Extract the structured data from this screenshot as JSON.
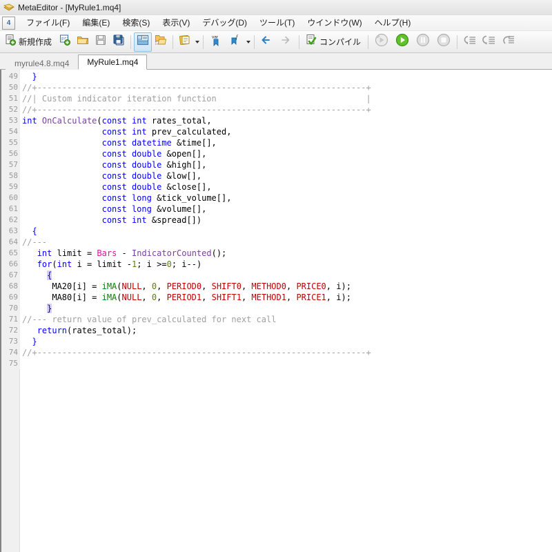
{
  "window": {
    "title": "MetaEditor - [MyRule1.mq4]",
    "icon": "metaeditor-diamond-icon"
  },
  "menubar": {
    "app_icon_label": "4",
    "items": [
      {
        "label": "ファイル(F)",
        "name": "menu-file"
      },
      {
        "label": "編集(E)",
        "name": "menu-edit"
      },
      {
        "label": "検索(S)",
        "name": "menu-search"
      },
      {
        "label": "表示(V)",
        "name": "menu-view"
      },
      {
        "label": "デバッグ(D)",
        "name": "menu-debug"
      },
      {
        "label": "ツール(T)",
        "name": "menu-tools"
      },
      {
        "label": "ウインドウ(W)",
        "name": "menu-window"
      },
      {
        "label": "ヘルプ(H)",
        "name": "menu-help"
      }
    ]
  },
  "toolbar": {
    "new_label": "新規作成",
    "compile_label": "コンパイル",
    "icons": [
      "new-file-icon",
      "new-project-icon",
      "open-folder-icon",
      "save-icon",
      "save-all-icon",
      "navigator-panel-icon",
      "open-data-folder-icon",
      "notes-icon",
      "variable-icon",
      "function-icon",
      "back-arrow-icon",
      "forward-arrow-icon",
      "compile-icon",
      "debug-step-icon",
      "start-icon",
      "pause-icon",
      "stop-icon",
      "step-into-icon",
      "step-over-icon",
      "step-out-icon"
    ]
  },
  "tabs": [
    {
      "label": "myrule4.8.mq4",
      "active": false
    },
    {
      "label": "MyRule1.mq4",
      "active": true
    }
  ],
  "editor": {
    "first_line": 49,
    "lines": [
      {
        "n": 49,
        "tokens": [
          {
            "t": "  ",
            "c": "plain"
          },
          {
            "t": "}",
            "c": "kw"
          }
        ]
      },
      {
        "n": 50,
        "tokens": [
          {
            "t": "//+------------------------------------------------------------------+",
            "c": "cmt"
          }
        ]
      },
      {
        "n": 51,
        "tokens": [
          {
            "t": "//| Custom indicator iteration function                              |",
            "c": "cmt"
          }
        ]
      },
      {
        "n": 52,
        "tokens": [
          {
            "t": "//+------------------------------------------------------------------+",
            "c": "cmt"
          }
        ]
      },
      {
        "n": 53,
        "tokens": [
          {
            "t": "int",
            "c": "kw"
          },
          {
            "t": " ",
            "c": "plain"
          },
          {
            "t": "OnCalculate",
            "c": "fn"
          },
          {
            "t": "(",
            "c": "plain"
          },
          {
            "t": "const",
            "c": "kw"
          },
          {
            "t": " ",
            "c": "plain"
          },
          {
            "t": "int",
            "c": "kw"
          },
          {
            "t": " rates_total,",
            "c": "plain"
          }
        ]
      },
      {
        "n": 54,
        "tokens": [
          {
            "t": "                ",
            "c": "plain"
          },
          {
            "t": "const",
            "c": "kw"
          },
          {
            "t": " ",
            "c": "plain"
          },
          {
            "t": "int",
            "c": "kw"
          },
          {
            "t": " prev_calculated,",
            "c": "plain"
          }
        ]
      },
      {
        "n": 55,
        "tokens": [
          {
            "t": "                ",
            "c": "plain"
          },
          {
            "t": "const",
            "c": "kw"
          },
          {
            "t": " ",
            "c": "plain"
          },
          {
            "t": "datetime",
            "c": "kw"
          },
          {
            "t": " &time[],",
            "c": "plain"
          }
        ]
      },
      {
        "n": 56,
        "tokens": [
          {
            "t": "                ",
            "c": "plain"
          },
          {
            "t": "const",
            "c": "kw"
          },
          {
            "t": " ",
            "c": "plain"
          },
          {
            "t": "double",
            "c": "kw"
          },
          {
            "t": " &open[],",
            "c": "plain"
          }
        ]
      },
      {
        "n": 57,
        "tokens": [
          {
            "t": "                ",
            "c": "plain"
          },
          {
            "t": "const",
            "c": "kw"
          },
          {
            "t": " ",
            "c": "plain"
          },
          {
            "t": "double",
            "c": "kw"
          },
          {
            "t": " &high[],",
            "c": "plain"
          }
        ]
      },
      {
        "n": 58,
        "tokens": [
          {
            "t": "                ",
            "c": "plain"
          },
          {
            "t": "const",
            "c": "kw"
          },
          {
            "t": " ",
            "c": "plain"
          },
          {
            "t": "double",
            "c": "kw"
          },
          {
            "t": " &low[],",
            "c": "plain"
          }
        ]
      },
      {
        "n": 59,
        "tokens": [
          {
            "t": "                ",
            "c": "plain"
          },
          {
            "t": "const",
            "c": "kw"
          },
          {
            "t": " ",
            "c": "plain"
          },
          {
            "t": "double",
            "c": "kw"
          },
          {
            "t": " &close[],",
            "c": "plain"
          }
        ]
      },
      {
        "n": 60,
        "tokens": [
          {
            "t": "                ",
            "c": "plain"
          },
          {
            "t": "const",
            "c": "kw"
          },
          {
            "t": " ",
            "c": "plain"
          },
          {
            "t": "long",
            "c": "kw"
          },
          {
            "t": " &tick_volume[],",
            "c": "plain"
          }
        ]
      },
      {
        "n": 61,
        "tokens": [
          {
            "t": "                ",
            "c": "plain"
          },
          {
            "t": "const",
            "c": "kw"
          },
          {
            "t": " ",
            "c": "plain"
          },
          {
            "t": "long",
            "c": "kw"
          },
          {
            "t": " &volume[],",
            "c": "plain"
          }
        ]
      },
      {
        "n": 62,
        "tokens": [
          {
            "t": "                ",
            "c": "plain"
          },
          {
            "t": "const",
            "c": "kw"
          },
          {
            "t": " ",
            "c": "plain"
          },
          {
            "t": "int",
            "c": "kw"
          },
          {
            "t": " &spread[])",
            "c": "plain"
          }
        ]
      },
      {
        "n": 63,
        "tokens": [
          {
            "t": "  ",
            "c": "plain"
          },
          {
            "t": "{",
            "c": "kw"
          }
        ]
      },
      {
        "n": 64,
        "tokens": [
          {
            "t": "//---",
            "c": "cmt"
          }
        ]
      },
      {
        "n": 65,
        "tokens": [
          {
            "t": "   ",
            "c": "plain"
          },
          {
            "t": "int",
            "c": "kw"
          },
          {
            "t": " limit = ",
            "c": "plain"
          },
          {
            "t": "Bars",
            "c": "pred"
          },
          {
            "t": " - ",
            "c": "plain"
          },
          {
            "t": "IndicatorCounted",
            "c": "fn"
          },
          {
            "t": "();",
            "c": "plain"
          }
        ]
      },
      {
        "n": 66,
        "tokens": [
          {
            "t": "   ",
            "c": "plain"
          },
          {
            "t": "for",
            "c": "kw"
          },
          {
            "t": "(",
            "c": "plain"
          },
          {
            "t": "int",
            "c": "kw"
          },
          {
            "t": " i = limit -",
            "c": "plain"
          },
          {
            "t": "1",
            "c": "num"
          },
          {
            "t": "; i >=",
            "c": "plain"
          },
          {
            "t": "0",
            "c": "num"
          },
          {
            "t": "; i--)",
            "c": "plain"
          }
        ]
      },
      {
        "n": 67,
        "tokens": [
          {
            "t": "     ",
            "c": "plain"
          },
          {
            "t": "{",
            "c": "brace"
          }
        ]
      },
      {
        "n": 68,
        "tokens": [
          {
            "t": "      MA20[i] = ",
            "c": "plain"
          },
          {
            "t": "iMA",
            "c": "fn2"
          },
          {
            "t": "(",
            "c": "plain"
          },
          {
            "t": "NULL",
            "c": "const"
          },
          {
            "t": ", ",
            "c": "plain"
          },
          {
            "t": "0",
            "c": "num"
          },
          {
            "t": ", ",
            "c": "plain"
          },
          {
            "t": "PERIOD0",
            "c": "const"
          },
          {
            "t": ", ",
            "c": "plain"
          },
          {
            "t": "SHIFT0",
            "c": "const"
          },
          {
            "t": ", ",
            "c": "plain"
          },
          {
            "t": "METHOD0",
            "c": "const"
          },
          {
            "t": ", ",
            "c": "plain"
          },
          {
            "t": "PRICE0",
            "c": "const"
          },
          {
            "t": ", i);",
            "c": "plain"
          }
        ]
      },
      {
        "n": 69,
        "tokens": [
          {
            "t": "      MA80[i] = ",
            "c": "plain"
          },
          {
            "t": "iMA",
            "c": "fn2"
          },
          {
            "t": "(",
            "c": "plain"
          },
          {
            "t": "NULL",
            "c": "const"
          },
          {
            "t": ", ",
            "c": "plain"
          },
          {
            "t": "0",
            "c": "num"
          },
          {
            "t": ", ",
            "c": "plain"
          },
          {
            "t": "PERIOD1",
            "c": "const"
          },
          {
            "t": ", ",
            "c": "plain"
          },
          {
            "t": "SHIFT1",
            "c": "const"
          },
          {
            "t": ", ",
            "c": "plain"
          },
          {
            "t": "METHOD1",
            "c": "const"
          },
          {
            "t": ", ",
            "c": "plain"
          },
          {
            "t": "PRICE1",
            "c": "const"
          },
          {
            "t": ", i);",
            "c": "plain"
          }
        ]
      },
      {
        "n": 70,
        "tokens": [
          {
            "t": "     ",
            "c": "plain"
          },
          {
            "t": "}",
            "c": "brace"
          }
        ]
      },
      {
        "n": 71,
        "tokens": [
          {
            "t": "//--- return value of prev_calculated for next call",
            "c": "cmt"
          }
        ]
      },
      {
        "n": 72,
        "tokens": [
          {
            "t": "   ",
            "c": "plain"
          },
          {
            "t": "return",
            "c": "kw"
          },
          {
            "t": "(rates_total);",
            "c": "plain"
          }
        ]
      },
      {
        "n": 73,
        "tokens": [
          {
            "t": "  ",
            "c": "plain"
          },
          {
            "t": "}",
            "c": "kw"
          }
        ]
      },
      {
        "n": 74,
        "tokens": [
          {
            "t": "//+------------------------------------------------------------------+",
            "c": "cmt"
          }
        ]
      },
      {
        "n": 75,
        "tokens": [
          {
            "t": "",
            "c": "plain"
          }
        ]
      }
    ]
  },
  "colors": {
    "keyword": "#0000ff",
    "function": "#7b3fa0",
    "builtin_function": "#008000",
    "constant": "#c00000",
    "number": "#5b7f00",
    "comment": "#a0a0a0",
    "predefined": "#e0169c",
    "plain": "#000000",
    "editor_background": "#ffffff",
    "gutter_background": "#f0f0f0"
  }
}
